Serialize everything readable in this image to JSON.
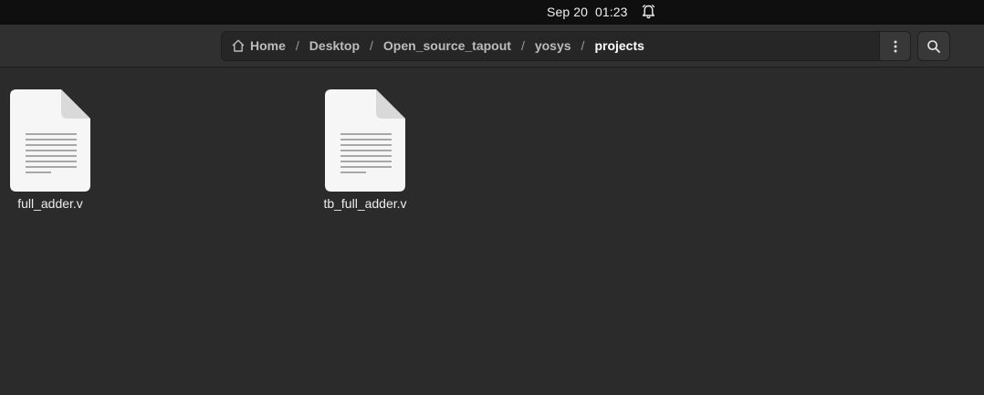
{
  "topbar": {
    "clock": "Sep 20  01:23",
    "alarm_icon": "bell-icon"
  },
  "pathbar": {
    "home_icon": "home-icon",
    "crumbs": [
      "Home",
      "Desktop",
      "Open_source_tapout",
      "yosys",
      "projects"
    ],
    "separator": "/"
  },
  "toolbar": {
    "menu_icon": "vertical-dots-icon",
    "search_icon": "search-icon"
  },
  "files": [
    {
      "name": "full_adder.v",
      "icon": "text-file-icon"
    },
    {
      "name": "tb_full_adder.v",
      "icon": "text-file-icon"
    }
  ]
}
